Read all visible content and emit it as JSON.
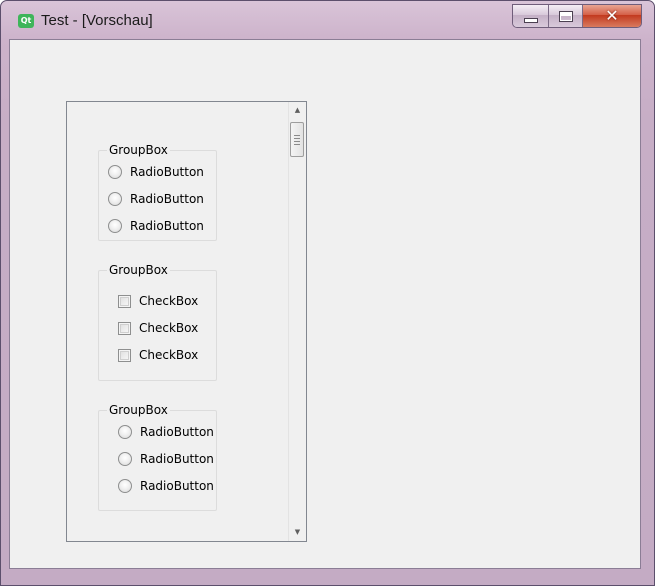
{
  "window": {
    "title": "Test - [Vorschau]",
    "app_icon": "qt-logo-icon",
    "app_icon_text": "Qt",
    "controls": [
      {
        "name": "minimize",
        "icon": "minimize-icon"
      },
      {
        "name": "maximize",
        "icon": "maximize-icon"
      },
      {
        "name": "close",
        "icon": "close-icon",
        "glyph": "✕"
      }
    ]
  },
  "scroll_area": {
    "scrollbar": {
      "up_arrow": "▲",
      "down_arrow": "▼"
    },
    "groups": [
      {
        "title": "GroupBox",
        "type": "radio",
        "items": [
          "RadioButton",
          "RadioButton",
          "RadioButton"
        ]
      },
      {
        "title": "GroupBox",
        "type": "checkbox",
        "items": [
          "CheckBox",
          "CheckBox",
          "CheckBox"
        ]
      },
      {
        "title": "GroupBox",
        "type": "radio",
        "items": [
          "RadioButton",
          "RadioButton",
          "RadioButton"
        ]
      }
    ]
  },
  "colors": {
    "frame": "#cdb3cb",
    "client_bg": "#f0f0f0",
    "close_button": "#c2391e"
  }
}
